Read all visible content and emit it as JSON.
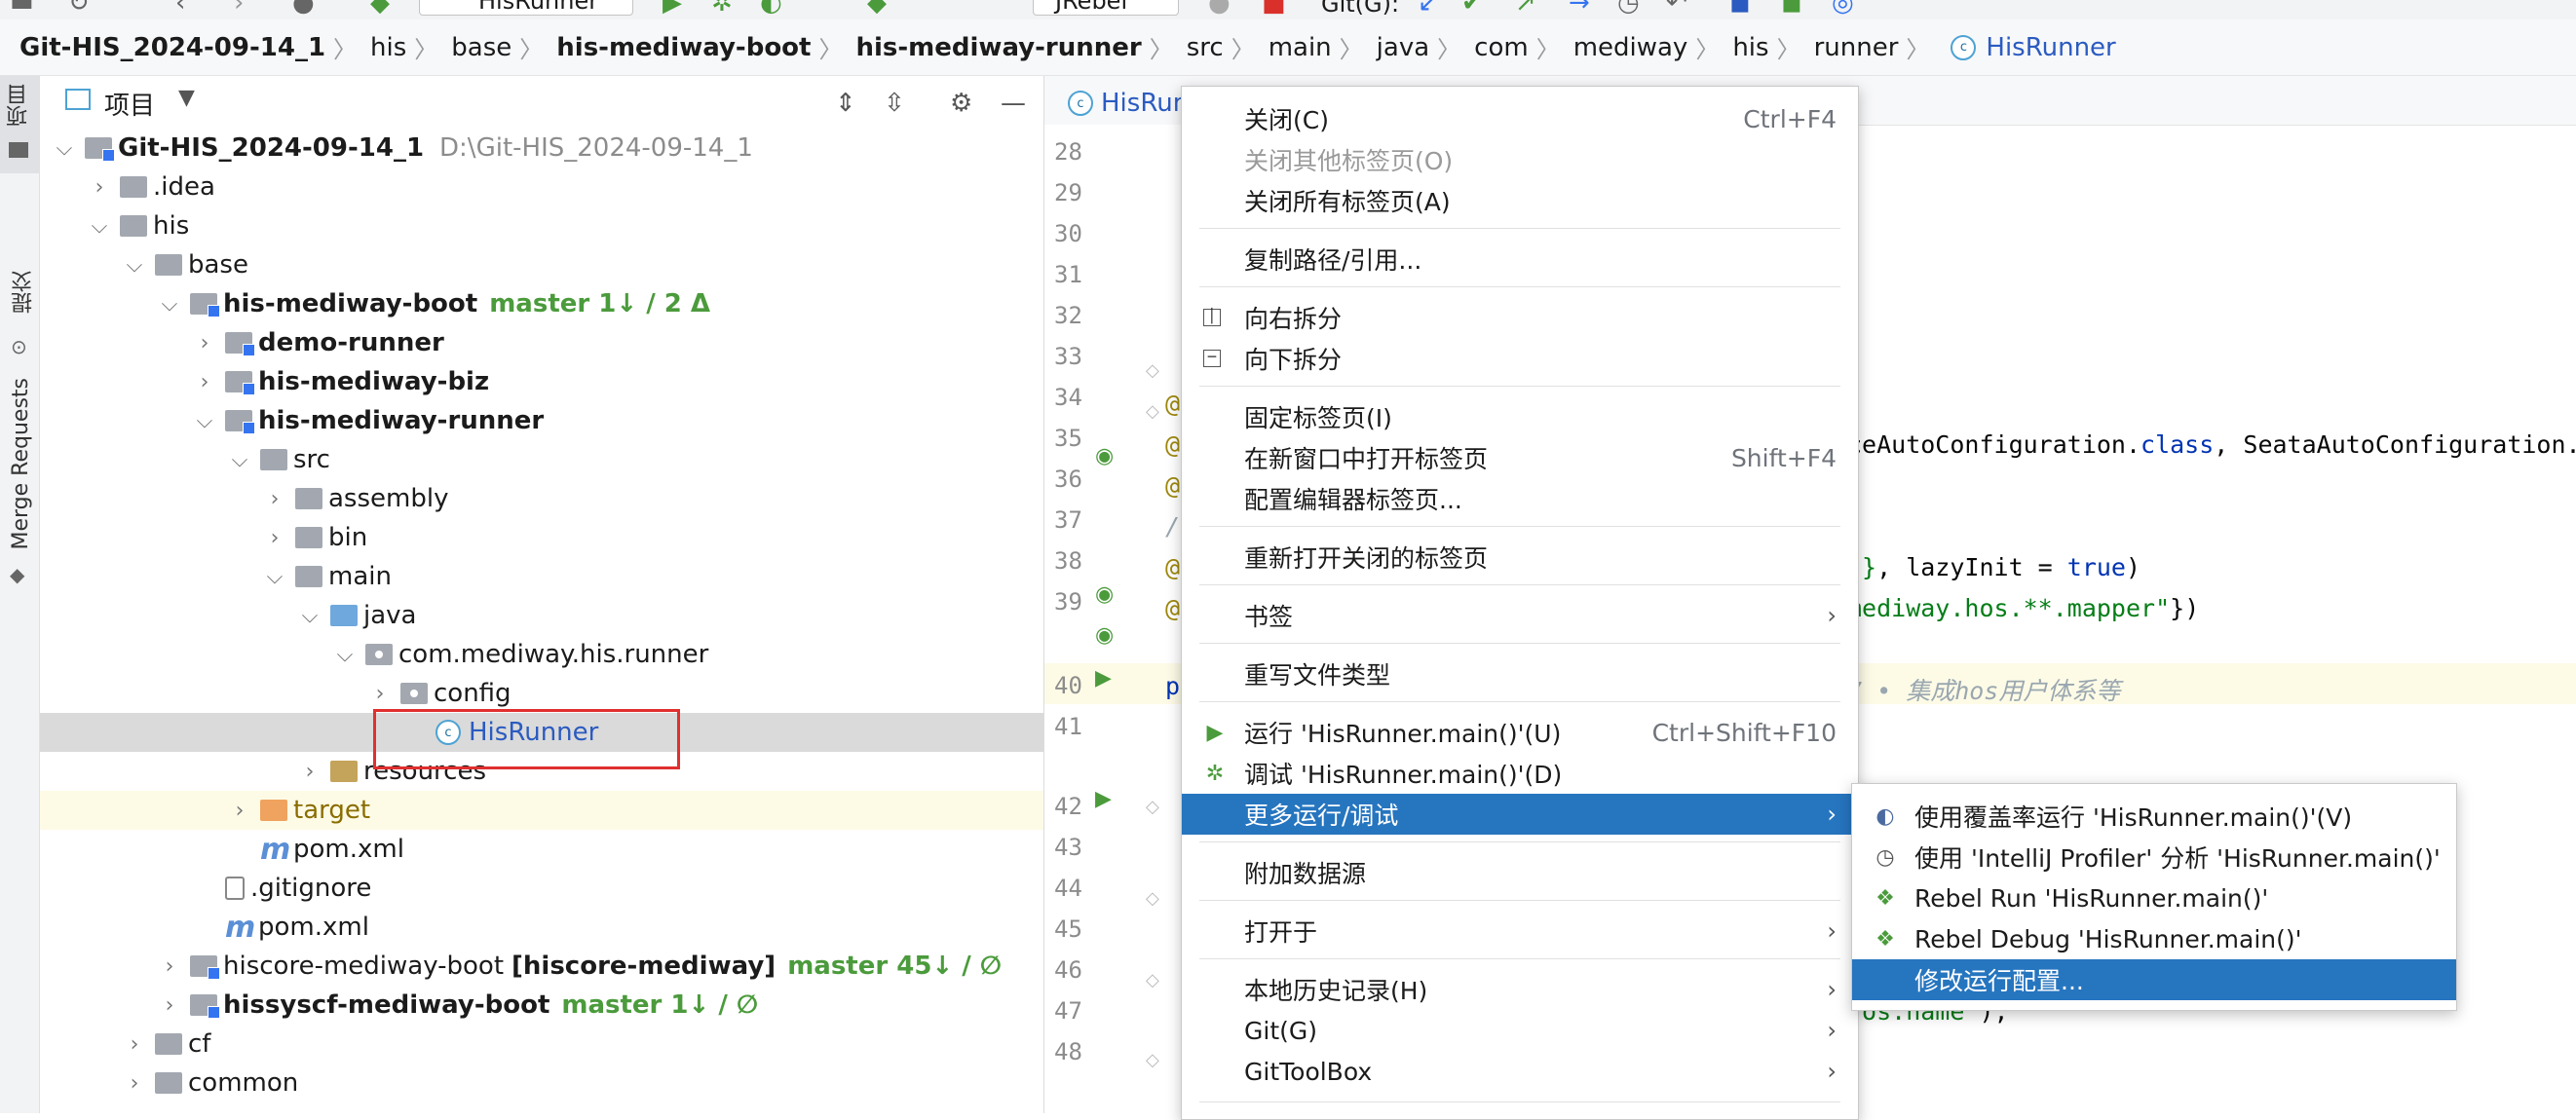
{
  "toolbar": {
    "run_config": "HisRunner",
    "jrebel": "JRebel",
    "git_label": "Git(G):"
  },
  "breadcrumb": [
    "Git-HIS_2024-09-14_1",
    "his",
    "base",
    "his-mediway-boot",
    "his-mediway-runner",
    "src",
    "main",
    "java",
    "com",
    "mediway",
    "his",
    "runner",
    "HisRunner"
  ],
  "left_strip": {
    "project": "项目",
    "commit": "提交",
    "merge_requests": "Merge Requests"
  },
  "project_panel": {
    "title": "项目",
    "tree": [
      {
        "label": "Git-HIS_2024-09-14_1",
        "path": "D:\\Git-HIS_2024-09-14_1"
      },
      {
        "label": ".idea"
      },
      {
        "label": "his"
      },
      {
        "label": "base"
      },
      {
        "label": "his-mediway-boot",
        "git": "master 1↓ / 2 Δ"
      },
      {
        "label": "demo-runner"
      },
      {
        "label": "his-mediway-biz"
      },
      {
        "label": "his-mediway-runner"
      },
      {
        "label": "src"
      },
      {
        "label": "assembly"
      },
      {
        "label": "bin"
      },
      {
        "label": "main"
      },
      {
        "label": "java"
      },
      {
        "label": "com.mediway.his.runner"
      },
      {
        "label": "config"
      },
      {
        "label": "HisRunner"
      },
      {
        "label": "resources"
      },
      {
        "label": "target"
      },
      {
        "label": "pom.xml"
      },
      {
        "label": ".gitignore"
      },
      {
        "label": "pom.xml"
      },
      {
        "label": "hiscore-mediway-boot",
        "extra": "[hiscore-mediway]",
        "git": "master 45↓ / ∅"
      },
      {
        "label": "hissyscf-mediway-boot",
        "git": "master 1↓ / ∅"
      },
      {
        "label": "cf"
      },
      {
        "label": "common"
      }
    ]
  },
  "editor": {
    "tab": "HisRun",
    "line_numbers": [
      "28",
      "29",
      "30",
      "31",
      "32",
      "33",
      "34",
      "35",
      "36",
      "37",
      "38",
      "39",
      "40",
      "41",
      "42",
      "43",
      "44",
      "45",
      "46",
      "47",
      "48"
    ],
    "code": {
      "l34": "@",
      "l35a": "@",
      "l35b": "ceAutoConfiguration.",
      "l35c": "class",
      "l35d": ", SeataAutoConfiguration.",
      "l36": "@",
      "l37": "/",
      "l38a": "@",
      "l38b": "\"}",
      "l38c": ", lazyInit = ",
      "l38d": "true",
      "l38e": ")",
      "l39a": "@",
      "l39b": "mediway.hos.**.mapper\"",
      "l39c": "})",
      "l40a": "p",
      "l40b": "7 • 集成hos用户体系等",
      "l47a": "\"os.name\"",
      "l47b": ");"
    }
  },
  "context_menu": {
    "items": [
      {
        "label": "关闭(C)",
        "shortcut": "Ctrl+F4"
      },
      {
        "label": "关闭其他标签页(O)",
        "disabled": true
      },
      {
        "label": "关闭所有标签页(A)"
      },
      {
        "label": "复制路径/引用..."
      },
      {
        "label": "向右拆分",
        "icon": "split-right-icon"
      },
      {
        "label": "向下拆分",
        "icon": "split-down-icon"
      },
      {
        "label": "固定标签页(I)"
      },
      {
        "label": "在新窗口中打开标签页",
        "shortcut": "Shift+F4"
      },
      {
        "label": "配置编辑器标签页..."
      },
      {
        "label": "重新打开关闭的标签页"
      },
      {
        "label": "书签",
        "submenu": true
      },
      {
        "label": "重写文件类型"
      },
      {
        "label": "运行 'HisRunner.main()'(U)",
        "shortcut": "Ctrl+Shift+F10",
        "icon": "run-icon"
      },
      {
        "label": "调试 'HisRunner.main()'(D)",
        "icon": "debug-icon"
      },
      {
        "label": "更多运行/调试",
        "submenu": true,
        "selected": true
      },
      {
        "label": "附加数据源"
      },
      {
        "label": "打开于",
        "submenu": true
      },
      {
        "label": "本地历史记录(H)",
        "submenu": true
      },
      {
        "label": "Git(G)",
        "submenu": true
      },
      {
        "label": "GitToolBox",
        "submenu": true
      }
    ]
  },
  "submenu": {
    "items": [
      {
        "label": "使用覆盖率运行 'HisRunner.main()'(V)",
        "icon": "coverage-icon"
      },
      {
        "label": "使用 'IntelliJ Profiler' 分析  'HisRunner.main()'",
        "icon": "profiler-icon"
      },
      {
        "label": "Rebel Run 'HisRunner.main()'",
        "icon": "rebel-run-icon"
      },
      {
        "label": "Rebel Debug 'HisRunner.main()'",
        "icon": "rebel-debug-icon"
      },
      {
        "label": "修改运行配置...",
        "selected": true
      }
    ]
  },
  "colors": {
    "accent": "#3574f0",
    "selection": "#2675bf",
    "git_green": "#4b9b3c",
    "highlight_red": "#e0302f"
  }
}
